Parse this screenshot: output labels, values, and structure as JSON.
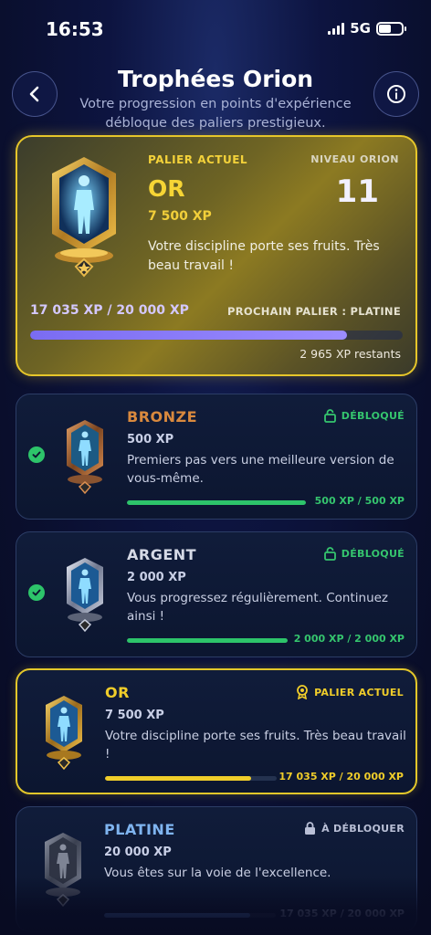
{
  "status_bar": {
    "time": "16:53",
    "network": "5G"
  },
  "header": {
    "title": "Trophées Orion",
    "subtitle": "Votre progression en points d'expérience débloque des paliers prestigieux."
  },
  "hero": {
    "current_label": "PALIER ACTUEL",
    "tier_name": "OR",
    "tier_xp": "7 500 XP",
    "description": "Votre discipline porte ses fruits. Très beau travail !",
    "level_label": "NIVEAU ORION",
    "level_value": "11",
    "progress_text": "17 035 XP / 20 000 XP",
    "next_label": "PROCHAIN PALIER : PLATINE",
    "progress_fraction": 0.85,
    "remaining": "2 965 XP restants"
  },
  "tiers": [
    {
      "name": "BRONZE",
      "xp": "500 XP",
      "description": "Premiers pas vers une meilleure version de vous-même.",
      "status": "DÉBLOQUÉ",
      "progress": "500 XP / 500 XP",
      "progress_fraction": 1.0,
      "color": "#d9893e"
    },
    {
      "name": "ARGENT",
      "xp": "2 000 XP",
      "description": "Vous progressez régulièrement. Continuez ainsi !",
      "status": "DÉBLOQUÉ",
      "progress": "2 000 XP / 2 000 XP",
      "progress_fraction": 1.0,
      "color": "#d6dae6"
    },
    {
      "name": "OR",
      "xp": "7 500 XP",
      "description": "Votre discipline porte ses fruits. Très beau travail !",
      "status": "PALIER ACTUEL",
      "progress": "17 035 XP / 20 000 XP",
      "progress_fraction": 0.85,
      "color": "#f0cd2a"
    },
    {
      "name": "PLATINE",
      "xp": "20 000 XP",
      "description": "Vous êtes sur la voie de l'excellence.",
      "status": "À DÉBLOQUER",
      "progress": "17 035 XP / 20 000 XP",
      "progress_fraction": 0.85,
      "color": "#7fb4f0"
    }
  ],
  "colors": {
    "accent_gold": "#e6c62a",
    "accent_purple": "#8a7cf6",
    "success_green": "#2dc46a",
    "locked_gray": "#b9bfd6"
  },
  "icons": {
    "back": "chevron-left-icon",
    "info": "info-icon",
    "unlocked": "unlock-icon",
    "current": "medal-icon",
    "locked": "lock-icon",
    "check": "check-circle-icon"
  }
}
